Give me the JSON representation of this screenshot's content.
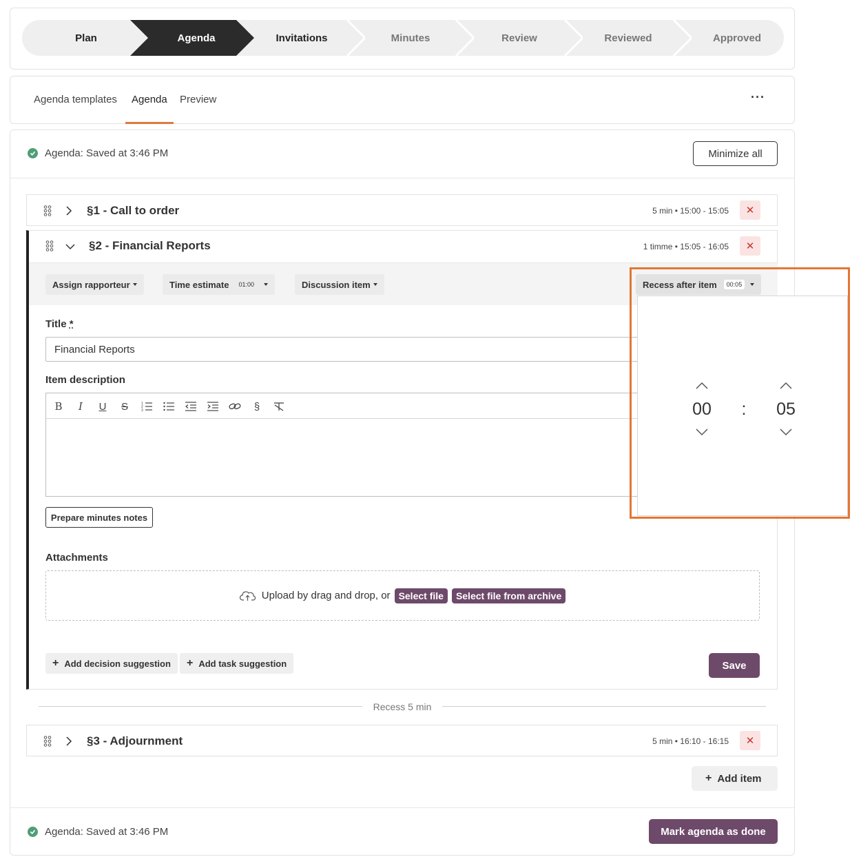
{
  "stepper": {
    "steps": [
      {
        "label": "Plan",
        "state": "done"
      },
      {
        "label": "Agenda",
        "state": "active"
      },
      {
        "label": "Invitations",
        "state": "next"
      },
      {
        "label": "Minutes",
        "state": "pending"
      },
      {
        "label": "Review",
        "state": "pending"
      },
      {
        "label": "Reviewed",
        "state": "pending"
      },
      {
        "label": "Approved",
        "state": "pending"
      }
    ]
  },
  "tabs": {
    "items": [
      "Agenda templates",
      "Agenda",
      "Preview"
    ],
    "active": "Agenda",
    "more_label": "···"
  },
  "status": {
    "top": "Agenda: Saved at 3:46 PM",
    "bottom": "Agenda: Saved at 3:46 PM",
    "minimize_label": "Minimize all"
  },
  "items": [
    {
      "title": "§1 - Call to order",
      "meta": "5 min • 15:00 - 15:05",
      "expanded": false
    },
    {
      "title": "§2 - Financial Reports",
      "meta": "1 timme • 15:05 - 16:05",
      "expanded": true
    },
    {
      "title": "§3 - Adjournment",
      "meta": "5 min • 16:10 - 16:15",
      "expanded": false
    }
  ],
  "editor": {
    "assign_label": "Assign rapporteur",
    "time_label": "Time estimate",
    "time_value": "01:00",
    "discussion_label": "Discussion item",
    "recess_label": "Recess after item",
    "recess_value": "00:05",
    "title_label": "Title",
    "title_required": "*",
    "title_value": "Financial Reports",
    "description_label": "Item description",
    "prepare_label": "Prepare minutes notes",
    "attachments_label": "Attachments",
    "upload_text": "Upload by drag and drop, or",
    "select_file": "Select file",
    "select_archive": "Select file from archive",
    "add_decision": "Add decision suggestion",
    "add_task": "Add task suggestion",
    "save_label": "Save",
    "format_tools": [
      "bold-icon",
      "italic-icon",
      "underline-icon",
      "strikethrough-icon",
      "ordered-list-icon",
      "bullet-list-icon",
      "outdent-icon",
      "indent-icon",
      "link-icon",
      "section-icon",
      "clear-format-icon"
    ]
  },
  "recess": {
    "text": "Recess 5 min"
  },
  "time_picker": {
    "hours": "00",
    "separator": ":",
    "minutes": "05"
  },
  "footer": {
    "add_item": "Add item",
    "mark_done": "Mark agenda as done"
  },
  "colors": {
    "accent": "#e07a3a",
    "purple": "#6e4a6a",
    "success": "#4f9e78",
    "danger": "#c0392b"
  }
}
